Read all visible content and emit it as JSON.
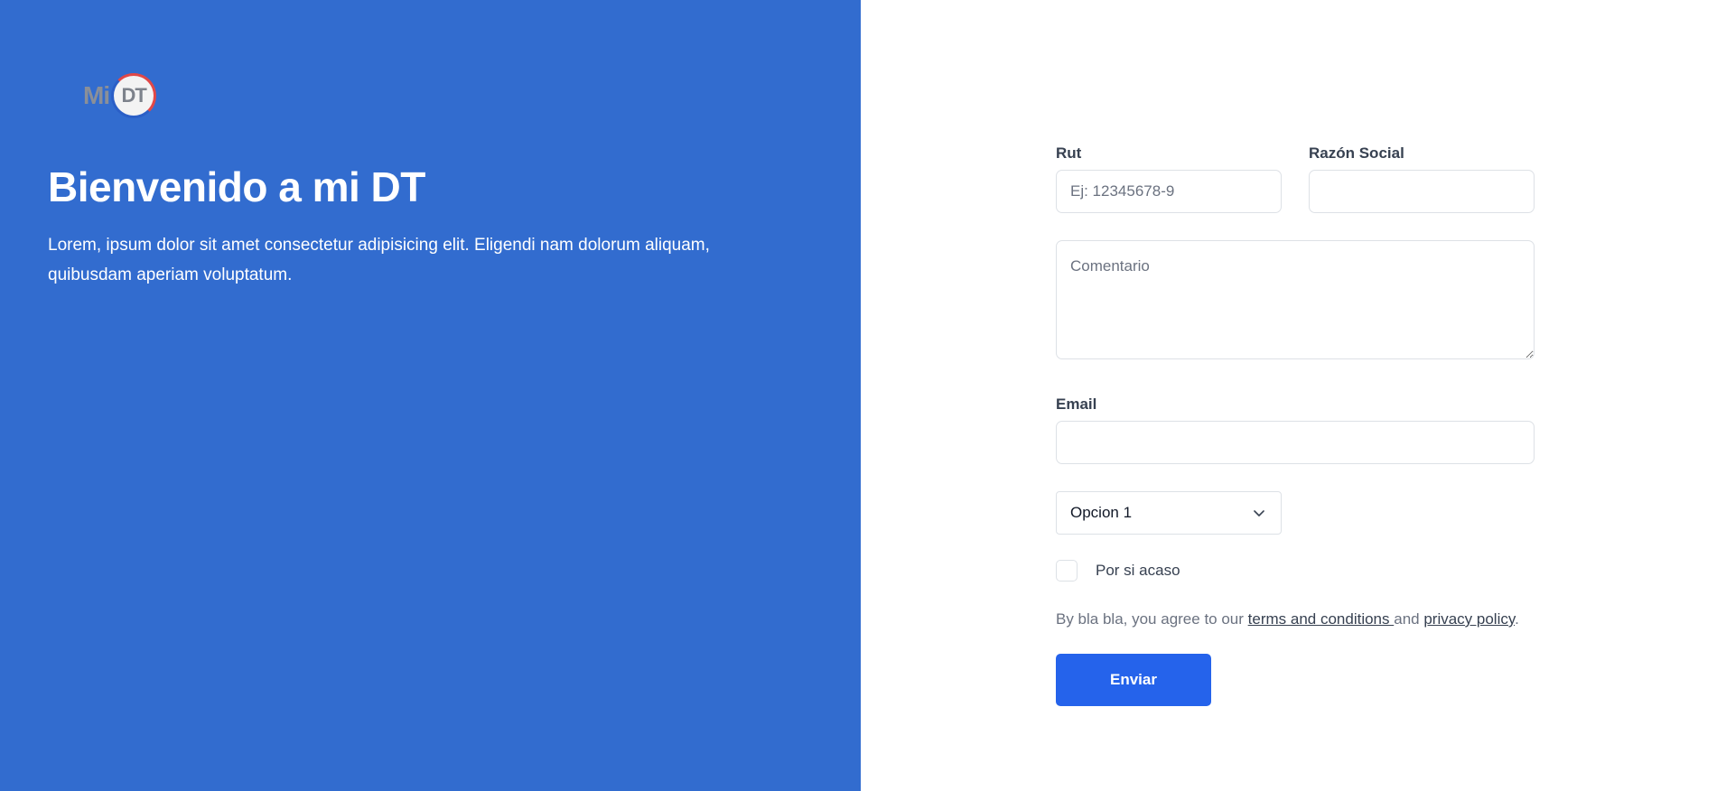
{
  "brand": {
    "logo_mi": "Mi",
    "logo_dt": "DT"
  },
  "hero": {
    "title": "Bienvenido a mi DT",
    "text": "Lorem, ipsum dolor sit amet consectetur adipisicing elit. Eligendi nam dolorum aliquam, quibusdam aperiam voluptatum."
  },
  "form": {
    "rut": {
      "label": "Rut",
      "placeholder": "Ej: 12345678-9",
      "value": ""
    },
    "razon_social": {
      "label": "Razón Social",
      "value": ""
    },
    "comentario": {
      "placeholder": "Comentario",
      "value": ""
    },
    "email": {
      "label": "Email",
      "value": ""
    },
    "select": {
      "selected": "Opcion 1",
      "icon": "chevron-down-icon"
    },
    "checkbox": {
      "label": "Por si acaso",
      "checked": false
    },
    "terms": {
      "prefix": "By bla bla, you agree to our ",
      "terms_link": "terms and conditions ",
      "middle": "and ",
      "privacy_link": "privacy policy",
      "suffix": "."
    },
    "submit_label": "Enviar"
  },
  "colors": {
    "left_panel": "#326ccf",
    "button": "#2563eb",
    "logo_red": "#e04848",
    "logo_blue": "#2b5fc7"
  }
}
